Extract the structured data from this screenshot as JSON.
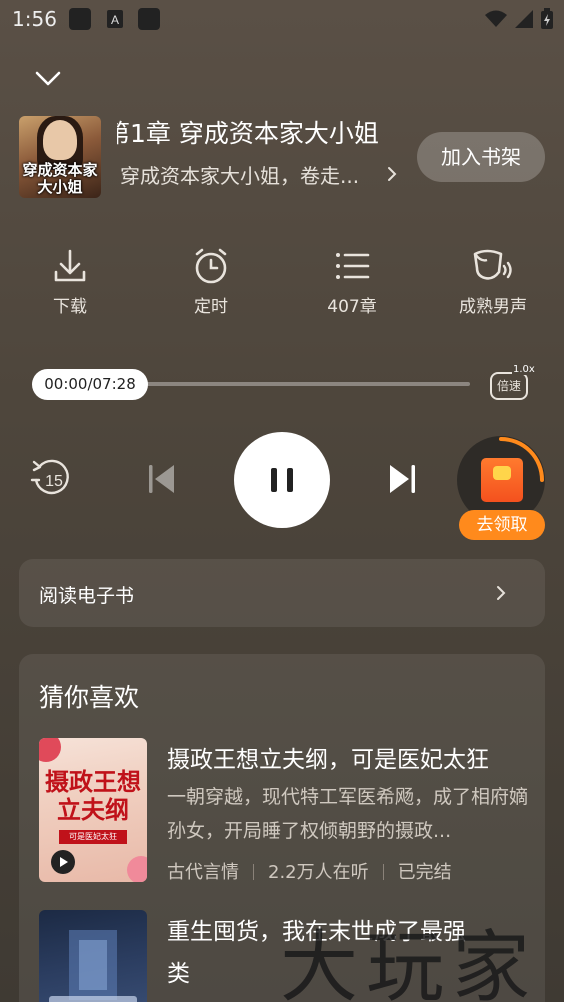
{
  "status_bar": {
    "time": "1:56",
    "icons": [
      "notification-box-icon",
      "a-icon",
      "notification-box-icon",
      "wifi-icon",
      "signal-icon",
      "battery-charging-icon"
    ]
  },
  "header": {
    "chapter_title": "第1章 穿成资本家大小姐",
    "book_subtitle": "穿成资本家大小姐，卷走...",
    "add_shelf_label": "加入书架",
    "cover_text": "穿成资本家大小姐"
  },
  "actions": [
    {
      "label": "下载",
      "icon": "download-icon"
    },
    {
      "label": "定时",
      "icon": "alarm-clock-icon"
    },
    {
      "label": "407章",
      "icon": "chapter-list-icon"
    },
    {
      "label": "成熟男声",
      "icon": "voice-icon"
    }
  ],
  "player": {
    "time_display": "00:00/07:28",
    "progress": 0.0,
    "speed_label": "倍速",
    "speed_value": "1.0x",
    "rewind_label": "15",
    "claim_label": "去领取"
  },
  "read_ebook": {
    "label": "阅读电子书"
  },
  "recommend": {
    "title": "猜你喜欢",
    "books": [
      {
        "title": "摄政王想立夫纲，可是医妃太狂",
        "desc": "一朝穿越，现代特工军医希飏，成了相府嫡孙女，开局睡了权倾朝野的摄政...",
        "genre": "古代言情",
        "listeners": "2.2万人在听",
        "status": "已完结",
        "cover_title": "摄政王想立夫纲",
        "cover_tag": "可是医妃太狂"
      },
      {
        "title": "重生囤货，我在末世成了最强",
        "title_line2": "类"
      }
    ]
  },
  "watermark": "大玩家"
}
